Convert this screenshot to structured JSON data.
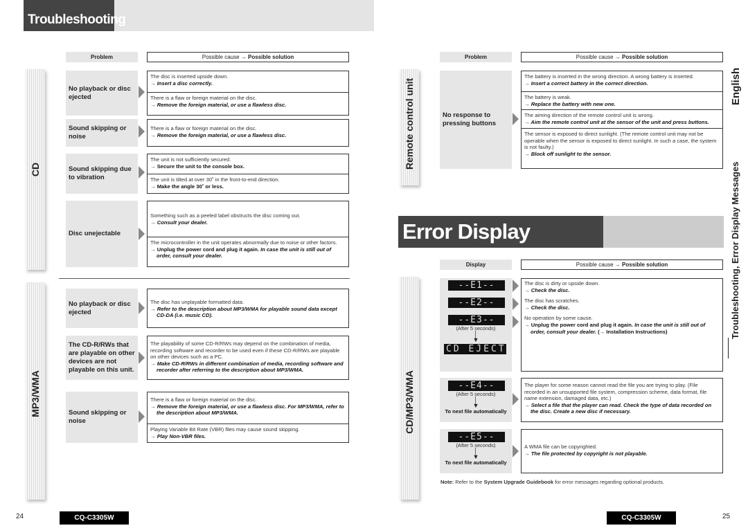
{
  "left_page": {
    "title": "Troubleshooting",
    "header": {
      "problem": "Problem",
      "cause_prefix": "Possible cause",
      "arrow": "→",
      "solution": "Possible solution"
    },
    "sections": [
      {
        "label": "CD",
        "rows": [
          {
            "problem": "No playback or disc ejected",
            "causes": [
              {
                "cause": "The disc is inserted upside down.",
                "solution": "Insert a disc correctly."
              },
              {
                "cause": "There is a flaw or foreign material on the disc.",
                "solution": "Remove the foreign material, or use a flawless disc."
              }
            ]
          },
          {
            "problem": "Sound skipping or noise",
            "causes": [
              {
                "cause": "There is a flaw or foreign material on the disc.",
                "solution": "Remove the foreign material, or use a flawless disc."
              }
            ]
          },
          {
            "problem": "Sound skipping due to vibration",
            "causes": [
              {
                "cause": "The unit is not sufficiently secured.",
                "solution": "Secure the unit to the console box."
              },
              {
                "cause": "The unit is tilted at over 30˚ in the front-to-end direction.",
                "solution": "Make the angle 30˚ or less."
              }
            ]
          },
          {
            "problem": "Disc unejectable",
            "causes": [
              {
                "cause": "Something such as a peeled label obstructs the disc coming out.",
                "solution": "Consult your dealer."
              },
              {
                "cause": "The microcontroller in the unit operates abnormally due to noise or other factors.",
                "solution": "Unplug the power cord and plug it again.",
                "solution_extra": "In case the unit is still out of order, consult your dealer."
              }
            ]
          }
        ]
      },
      {
        "label": "MP3/WMA",
        "rows": [
          {
            "problem": "No playback or disc ejected",
            "causes": [
              {
                "cause": "The disc has unplayable formatted data.",
                "solution": "Refer to the description about MP3/WMA for playable sound data except CD-DA (i.e. music CD)."
              }
            ]
          },
          {
            "problem": "The CD-R/RWs that are playable on other devices are not playable on this unit.",
            "causes": [
              {
                "cause": "The playability of some CD-R/RWs may depend on the combination of media, recording software and recorder to be used even if these CD-R/RWs are playable on other devices such as a PC.",
                "solution": "Make CD-R/RWs in different combination of media, recording software and recorder after referring to the description about MP3/WMA."
              }
            ]
          },
          {
            "problem": "Sound skipping or noise",
            "causes": [
              {
                "cause": "There is a flaw or foreign material on the disc.",
                "solution": "Remove the foreign material, or use a flawless disc. For MP3/WMA, refer to the description about MP3/WMA."
              },
              {
                "cause": "Playing Variable Bit Rate (VBR) files may cause sound skipping.",
                "solution": "Play Non-VBR files."
              }
            ]
          }
        ]
      }
    ],
    "page_number": "24",
    "model": "CQ-C3305W"
  },
  "right_page": {
    "header": {
      "problem": "Problem",
      "cause_prefix": "Possible cause",
      "arrow": "→",
      "solution": "Possible solution"
    },
    "remote": {
      "label": "Remote control unit",
      "problem": "No response to pressing buttons",
      "causes": [
        {
          "cause": "The battery is inserted in the wrong direction. A wrong battery is inserted.",
          "solution": "Insert a correct battery in the correct direction."
        },
        {
          "cause": "The battery is weak.",
          "solution": "Replace the battery with new one."
        },
        {
          "cause": "The aiming direction of the remote control unit is wrong.",
          "solution": "Aim the remote control unit at the sensor of the unit and press buttons."
        },
        {
          "cause": "The sensor is exposed to direct sunlight. (The remote control unit may not be operable when the sensor is exposed to direct sunlight. In such a case, the system is not faulty.)",
          "solution": "Block off sunlight to the sensor."
        }
      ]
    },
    "error_title": "Error Display Messages",
    "error_header": {
      "display": "Display",
      "cause_prefix": "Possible cause",
      "arrow": "→",
      "solution": "Possible solution"
    },
    "error_section_label": "CD/MP3/WMA",
    "errors": {
      "e1": {
        "display": "--E1--",
        "cause": "The disc is dirty or upside down.",
        "solution": "Check the disc."
      },
      "e2": {
        "display": "--E2--",
        "cause": "The disc has scratches.",
        "solution": "Check the disc."
      },
      "e3": {
        "display": "--E3--",
        "after": "(After 5 seconds)",
        "result_display": "CD EJECT",
        "cause": "No operation by some cause.",
        "solution": "Unplug the power cord and plug it again.",
        "solution_extra": "In case the unit is still out of order, consult your dealer.",
        "ref": "(→ Installation Instructions)"
      },
      "e4": {
        "display": "--E4--",
        "after": "(After 5 seconds)",
        "result": "To next file automatically",
        "cause": "The player for some reason cannot read the file you are trying to play. (File recorded in an unsupported file system, compression scheme, data format, file name extension, damaged data, etc.)",
        "solution": "Select a file that the player can read. Check the type of data recorded on the disc. Create a new disc if necessary."
      },
      "e5": {
        "display": "--E5--",
        "after": "(After 5 seconds)",
        "result": "To next file automatically",
        "cause": "A WMA file can be copyrighted.",
        "solution": "The file protected by copyright is not playable."
      }
    },
    "note_label": "Note:",
    "note_pre": "Refer to the",
    "note_bold": "System Upgrade Guidebook",
    "note_post": "for error messages regarding optional products.",
    "side_language": "English",
    "side_section": "Troubleshooting, Error Display Messages",
    "page_number": "25",
    "model": "CQ-C3305W"
  }
}
